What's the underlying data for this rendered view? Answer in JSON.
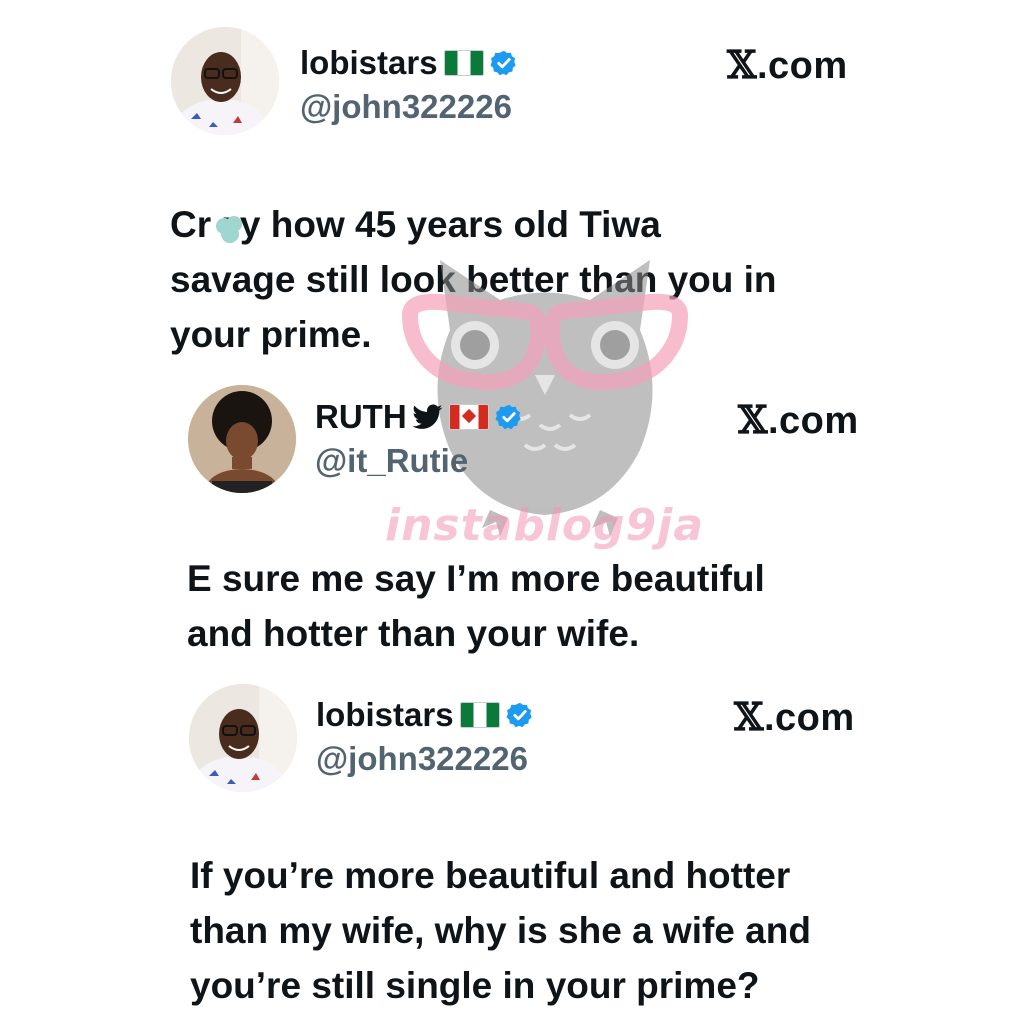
{
  "posts": [
    {
      "display_name": "lobistars",
      "flag_icon": "nigeria-flag-icon",
      "verified_icon": "verified-badge-icon",
      "handle": "@john322226",
      "source": ".com",
      "source_mark": "𝕏",
      "body_lines": [
        "Cr  zy how 45 years old Tiwa",
        "savage still look better than you in",
        "your prime."
      ]
    },
    {
      "display_name": "RUTH",
      "bird_icon": "twitter-bird-icon",
      "flag_icon": "canada-flag-icon",
      "verified_icon": "verified-badge-icon",
      "handle": "@it_Rutie",
      "source": ".com",
      "source_mark": "𝕏",
      "body_lines": [
        "E sure me say I’m more beautiful",
        "and hotter than your wife."
      ]
    },
    {
      "display_name": "lobistars",
      "flag_icon": "nigeria-flag-icon",
      "verified_icon": "verified-badge-icon",
      "handle": "@john322226",
      "source": ".com",
      "source_mark": "𝕏",
      "body_lines": [
        "If you’re more beautiful and hotter",
        "than my wife, why is she a wife and",
        "you’re still single in your prime?"
      ]
    }
  ],
  "watermark": {
    "text": "instablog9ja",
    "icon": "owl-glasses-logo-icon"
  },
  "colors": {
    "verified_blue": "#1d9bf0",
    "handle_gray": "#536471",
    "watermark_pink": "#f096b4",
    "watermark_gray": "#8a8a8a"
  }
}
